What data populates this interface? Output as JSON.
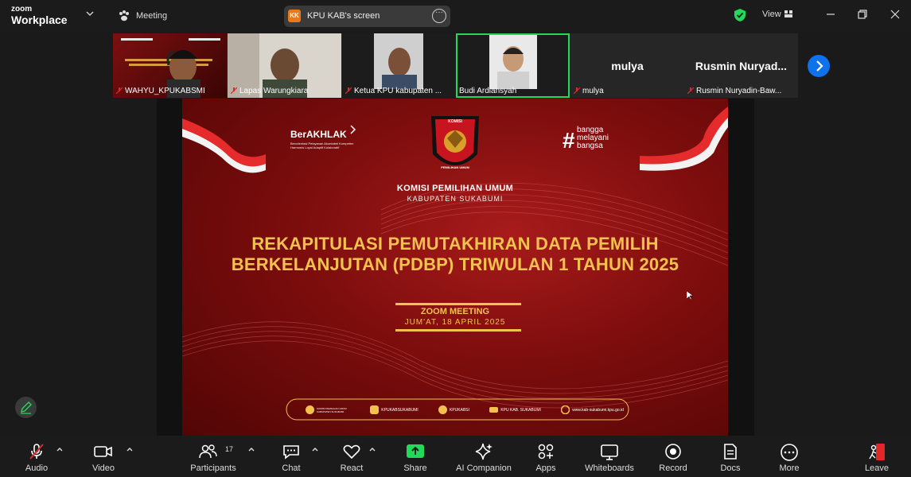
{
  "app": {
    "brand_top": "zoom",
    "brand_bottom": "Workplace",
    "meeting_label": "Meeting",
    "view_label": "View"
  },
  "share": {
    "initials": "KK",
    "label": "KPU KAB's screen"
  },
  "participants_strip": [
    {
      "name": "WAHYU_KPUKABSMI",
      "type": "video"
    },
    {
      "name": "Lapas Warungkiara",
      "type": "video"
    },
    {
      "name": "Ketua KPU kabupaten ...",
      "type": "video"
    },
    {
      "name": "Budi Ardiansyah",
      "type": "video",
      "active": true
    },
    {
      "name": "mulya",
      "type": "name",
      "big": "mulya"
    },
    {
      "name": "Rusmin Nuryadin-Baw...",
      "type": "name",
      "big": "Rusmin  Nuryad..."
    }
  ],
  "slide": {
    "logo_left_title": "BerAKHLAK",
    "logo_left_sub1": "Berorientasi Pelayanan Akuntabel Kompeten",
    "logo_left_sub2": "Harmonis Loyal Adaptif Kolaboratif",
    "logo_right_1": "bangga",
    "logo_right_2": "melayani",
    "logo_right_3": "bangsa",
    "emblem_top": "KOMISI",
    "emblem_bottom": "PEMILIHAN UMUM",
    "org_line1": "KOMISI PEMILIHAN UMUM",
    "org_line2": "KABUPATEN SUKABUMI",
    "title_line1": "REKAPITULASI PEMUTAKHIRAN DATA PEMILIH",
    "title_line2": "BERKELANJUTAN (PDBP) TRIWULAN 1 TAHUN 2025",
    "event": "ZOOM MEETING",
    "date": "JUM'AT, 18 APRIL 2025",
    "socials": [
      {
        "icon": "facebook-icon",
        "text": "KOMISI PEMILIHAN UMUM KABUPATEN SUKABUMI"
      },
      {
        "icon": "instagram-icon",
        "text": "KPUKABSUKABUMI"
      },
      {
        "icon": "x-icon",
        "text": "KPUKABSI"
      },
      {
        "icon": "youtube-icon",
        "text": "KPU KAB. SUKABUMI"
      },
      {
        "icon": "web-icon",
        "text": "www.kab-sukabumi.kpu.go.id"
      }
    ]
  },
  "toolbar": {
    "audio": "Audio",
    "video": "Video",
    "participants": "Participants",
    "participants_count": "17",
    "chat": "Chat",
    "react": "React",
    "share": "Share",
    "ai_companion": "AI Companion",
    "apps": "Apps",
    "whiteboards": "Whiteboards",
    "record": "Record",
    "docs": "Docs",
    "more": "More",
    "leave": "Leave"
  },
  "colors": {
    "accent_blue": "#0e72ed",
    "share_green": "#23d959",
    "active_border": "#23d959",
    "slide_gold": "#f2c14e",
    "leave_red": "#e02828"
  }
}
